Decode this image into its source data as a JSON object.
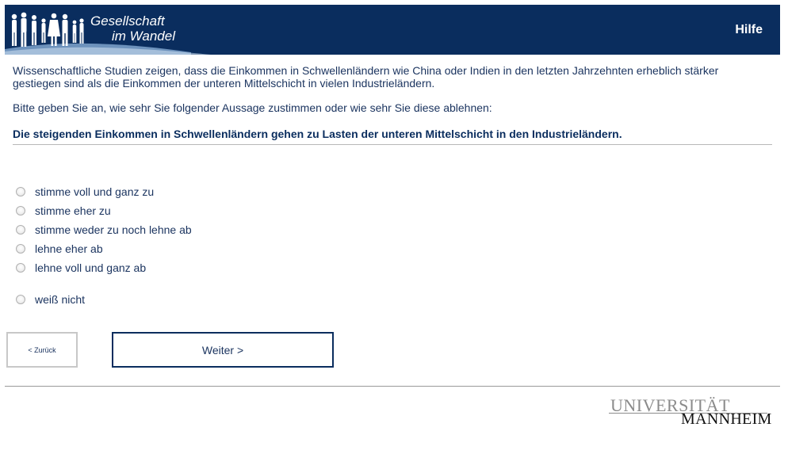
{
  "header": {
    "logo_line1": "Gesellschaft",
    "logo_line2": "im Wandel",
    "help_label": "Hilfe"
  },
  "question": {
    "intro": "Wissenschaftliche Studien zeigen, dass die Einkommen in Schwellenländern wie China oder Indien in den letzten Jahrzehnten erheblich stärker gestiegen sind als die Einkommen der unteren Mittelschicht in vielen Industrieländern.",
    "instruction": "Bitte geben Sie an, wie sehr Sie folgender Aussage zustimmen oder wie sehr Sie diese ablehnen:",
    "statement": "Die steigenden Einkommen in Schwellenländern gehen zu Lasten der unteren Mittelschicht in den Industrieländern."
  },
  "options": [
    {
      "label": "stimme voll und ganz zu",
      "selected": false
    },
    {
      "label": "stimme eher zu",
      "selected": false
    },
    {
      "label": "stimme weder zu noch lehne ab",
      "selected": false
    },
    {
      "label": "lehne eher ab",
      "selected": false
    },
    {
      "label": "lehne voll und ganz ab",
      "selected": false
    },
    {
      "label": "weiß nicht",
      "selected": false
    }
  ],
  "navigation": {
    "back_label": "< Zurück",
    "next_label": "Weiter >"
  },
  "footer": {
    "uni_line1": "UNIVERSITÄT",
    "uni_line2": "MANNHEIM"
  },
  "colors": {
    "header_bg": "#0a2d5e",
    "text": "#1c3560",
    "accent_light": "#8fb4dc"
  }
}
